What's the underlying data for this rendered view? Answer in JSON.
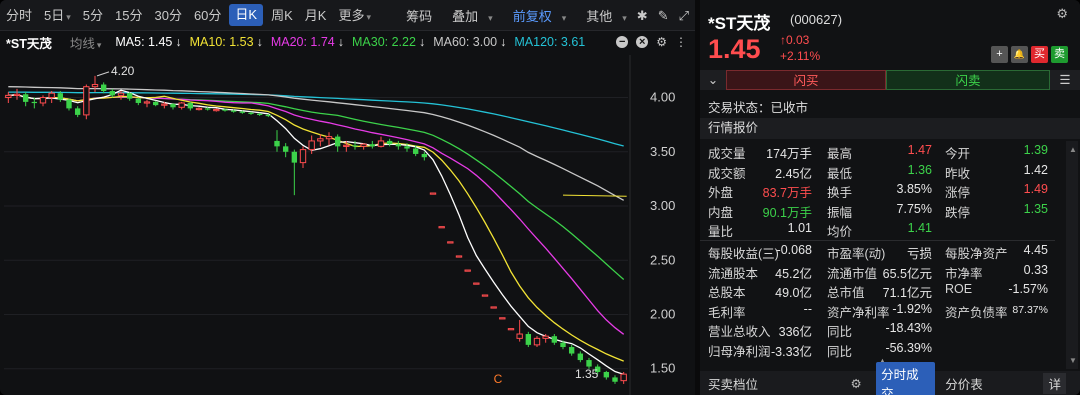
{
  "toolbar": {
    "tabs": [
      {
        "label": "分时"
      },
      {
        "label": "5日"
      },
      {
        "label": "5分"
      },
      {
        "label": "15分"
      },
      {
        "label": "30分"
      },
      {
        "label": "60分"
      },
      {
        "label": "日K"
      },
      {
        "label": "周K"
      },
      {
        "label": "月K"
      },
      {
        "label": "更多"
      }
    ],
    "active_tab": "日K",
    "right": {
      "chips": "筹码",
      "overlay": "叠加",
      "adjust": "前复权",
      "other": "其他"
    }
  },
  "ma_bar": {
    "stock": "*ST天茂",
    "group": "均线",
    "items": [
      {
        "label": "MA5: 1.45",
        "arrow": "↓",
        "color": "#ffffff"
      },
      {
        "label": "MA10: 1.53",
        "arrow": "↓",
        "color": "#f2e335"
      },
      {
        "label": "MA20: 1.74",
        "arrow": "↓",
        "color": "#e63be6"
      },
      {
        "label": "MA30: 2.22",
        "arrow": "↓",
        "color": "#3cd24a"
      },
      {
        "label": "MA60: 3.00",
        "arrow": "↓",
        "color": "#c8c8c8"
      },
      {
        "label": "MA120: 3.61",
        "arrow": "",
        "color": "#24c2d6"
      }
    ]
  },
  "chart_data": {
    "type": "candlestick",
    "y_ticks": [
      "4.00",
      "3.50",
      "3.00",
      "2.50",
      "2.00",
      "1.50"
    ],
    "ylim": [
      1.35,
      4.3
    ],
    "annotations": {
      "high": "4.20",
      "low": "1.35",
      "marker": "C"
    },
    "current_price": "1.45",
    "candles": [
      [
        4.0,
        4.05,
        3.95,
        4.02
      ],
      [
        4.02,
        4.08,
        3.98,
        4.03
      ],
      [
        4.03,
        4.05,
        3.92,
        3.96
      ],
      [
        3.96,
        4.0,
        3.9,
        3.95
      ],
      [
        3.95,
        4.02,
        3.92,
        4.0
      ],
      [
        4.0,
        4.06,
        3.95,
        4.04
      ],
      [
        4.04,
        4.06,
        3.96,
        3.98
      ],
      [
        3.98,
        3.99,
        3.88,
        3.9
      ],
      [
        3.9,
        3.92,
        3.82,
        3.84
      ],
      [
        3.84,
        4.12,
        3.8,
        4.1
      ],
      [
        4.1,
        4.2,
        4.05,
        4.12
      ],
      [
        4.12,
        4.14,
        4.04,
        4.06
      ],
      [
        4.06,
        4.08,
        4.0,
        4.02
      ],
      [
        4.02,
        4.06,
        3.98,
        4.04
      ],
      [
        4.04,
        4.05,
        3.97,
        3.99
      ],
      [
        3.99,
        4.0,
        3.93,
        3.95
      ],
      [
        3.95,
        3.98,
        3.91,
        3.96
      ],
      [
        3.96,
        3.97,
        3.92,
        3.93
      ],
      [
        3.93,
        3.96,
        3.9,
        3.94
      ],
      [
        3.94,
        3.95,
        3.89,
        3.91
      ],
      [
        3.91,
        3.96,
        3.89,
        3.95
      ],
      [
        3.95,
        3.96,
        3.88,
        3.9
      ],
      [
        3.9,
        3.91,
        3.88,
        3.9
      ],
      [
        3.9,
        3.91,
        3.88,
        3.89
      ],
      [
        3.89,
        3.9,
        3.87,
        3.89
      ],
      [
        3.89,
        3.9,
        3.87,
        3.88
      ],
      [
        3.88,
        3.89,
        3.86,
        3.87
      ],
      [
        3.87,
        3.88,
        3.85,
        3.86
      ],
      [
        3.86,
        3.87,
        3.84,
        3.85
      ],
      [
        3.85,
        3.86,
        3.83,
        3.84
      ],
      [
        3.84,
        3.85,
        3.82,
        3.83
      ],
      [
        3.6,
        3.7,
        3.5,
        3.55
      ],
      [
        3.55,
        3.58,
        3.45,
        3.5
      ],
      [
        3.5,
        3.52,
        3.1,
        3.4
      ],
      [
        3.4,
        3.55,
        3.35,
        3.52
      ],
      [
        3.52,
        3.65,
        3.48,
        3.6
      ],
      [
        3.6,
        3.66,
        3.55,
        3.62
      ],
      [
        3.62,
        3.68,
        3.56,
        3.64
      ],
      [
        3.64,
        3.66,
        3.5,
        3.55
      ],
      [
        3.55,
        3.6,
        3.5,
        3.56
      ],
      [
        3.56,
        3.6,
        3.52,
        3.55
      ],
      [
        3.55,
        3.58,
        3.52,
        3.57
      ],
      [
        3.57,
        3.6,
        3.53,
        3.55
      ],
      [
        3.55,
        3.64,
        3.54,
        3.6
      ],
      [
        3.6,
        3.62,
        3.55,
        3.57
      ],
      [
        3.57,
        3.6,
        3.52,
        3.55
      ],
      [
        3.55,
        3.58,
        3.5,
        3.53
      ],
      [
        3.53,
        3.56,
        3.46,
        3.48
      ],
      [
        3.48,
        3.5,
        3.42,
        3.45
      ],
      [
        3.12,
        3.12,
        3.12,
        3.12
      ],
      [
        2.81,
        2.81,
        2.81,
        2.81
      ],
      [
        2.67,
        2.67,
        2.67,
        2.67
      ],
      [
        2.54,
        2.54,
        2.54,
        2.54
      ],
      [
        2.41,
        2.41,
        2.41,
        2.41
      ],
      [
        2.29,
        2.29,
        2.29,
        2.29
      ],
      [
        2.18,
        2.18,
        2.18,
        2.18
      ],
      [
        2.07,
        2.07,
        2.07,
        2.07
      ],
      [
        1.97,
        1.97,
        1.97,
        1.97
      ],
      [
        1.87,
        1.87,
        1.87,
        1.87
      ],
      [
        1.78,
        1.95,
        1.75,
        1.82
      ],
      [
        1.82,
        1.84,
        1.7,
        1.72
      ],
      [
        1.72,
        1.8,
        1.7,
        1.78
      ],
      [
        1.78,
        1.82,
        1.74,
        1.8
      ],
      [
        1.8,
        1.82,
        1.72,
        1.74
      ],
      [
        1.74,
        1.76,
        1.68,
        1.7
      ],
      [
        1.7,
        1.72,
        1.62,
        1.64
      ],
      [
        1.64,
        1.66,
        1.56,
        1.58
      ],
      [
        1.58,
        1.6,
        1.5,
        1.52
      ],
      [
        1.52,
        1.54,
        1.45,
        1.47
      ],
      [
        1.47,
        1.48,
        1.4,
        1.42
      ],
      [
        1.42,
        1.44,
        1.36,
        1.38
      ],
      [
        1.39,
        1.47,
        1.36,
        1.45
      ]
    ]
  },
  "quote": {
    "name": "*ST天茂",
    "code": "(000627)",
    "price": "1.45",
    "change": "0.03",
    "change_pct": "+2.11%",
    "buttons": {
      "plus": "+",
      "bell": "🔔",
      "buy": "买",
      "sell": "卖"
    },
    "flash_buy": "闪买",
    "flash_sell": "闪卖",
    "trading_status": "交易状态：已收市",
    "section_title": "行情报价",
    "rows": [
      [
        {
          "l": "成交量",
          "v": "174万手",
          "c": "w"
        },
        {
          "l": "最高",
          "v": "1.47",
          "c": "r"
        },
        {
          "l": "今开",
          "v": "1.39",
          "c": "g"
        }
      ],
      [
        {
          "l": "成交额",
          "v": "2.45亿",
          "c": "w"
        },
        {
          "l": "最低",
          "v": "1.36",
          "c": "g"
        },
        {
          "l": "昨收",
          "v": "1.42",
          "c": "w"
        }
      ],
      [
        {
          "l": "外盘",
          "v": "83.7万手",
          "c": "r"
        },
        {
          "l": "换手",
          "v": "3.85%",
          "c": "w"
        },
        {
          "l": "涨停",
          "v": "1.49",
          "c": "r"
        }
      ],
      [
        {
          "l": "内盘",
          "v": "90.1万手",
          "c": "g"
        },
        {
          "l": "振幅",
          "v": "7.75%",
          "c": "w"
        },
        {
          "l": "跌停",
          "v": "1.35",
          "c": "g"
        }
      ],
      [
        {
          "l": "量比",
          "v": "1.01",
          "c": "w"
        },
        {
          "l": "均价",
          "v": "1.41",
          "c": "g"
        }
      ]
    ],
    "fin_rows": [
      [
        {
          "l": "每股收益(三)",
          "v": "-0.068"
        },
        {
          "l": "市盈率(动)",
          "v": "亏损"
        },
        {
          "l": "每股净资产",
          "v": "4.45"
        }
      ],
      [
        {
          "l": "流通股本",
          "v": "45.2亿"
        },
        {
          "l": "流通市值",
          "v": "65.5亿元"
        },
        {
          "l": "市净率",
          "v": "0.33"
        }
      ],
      [
        {
          "l": "总股本",
          "v": "49.0亿"
        },
        {
          "l": "总市值",
          "v": "71.1亿元"
        },
        {
          "l": "ROE",
          "v": "-1.57%"
        }
      ],
      [
        {
          "l": "毛利率",
          "v": "--"
        },
        {
          "l": "资产净利率",
          "v": "-1.92%"
        },
        {
          "l": "资产负债率",
          "v": "87.37%"
        }
      ],
      [
        {
          "l": "营业总收入",
          "v": "336亿"
        },
        {
          "l": "同比",
          "v": "-18.43%"
        }
      ],
      [
        {
          "l": "归母净利润",
          "v": "-3.33亿"
        },
        {
          "l": "同比",
          "v": "-56.39%"
        }
      ]
    ],
    "bottom": {
      "orderbook": "买卖档位",
      "ticks": "分时成交",
      "price_table": "分价表",
      "detail": "详"
    }
  }
}
